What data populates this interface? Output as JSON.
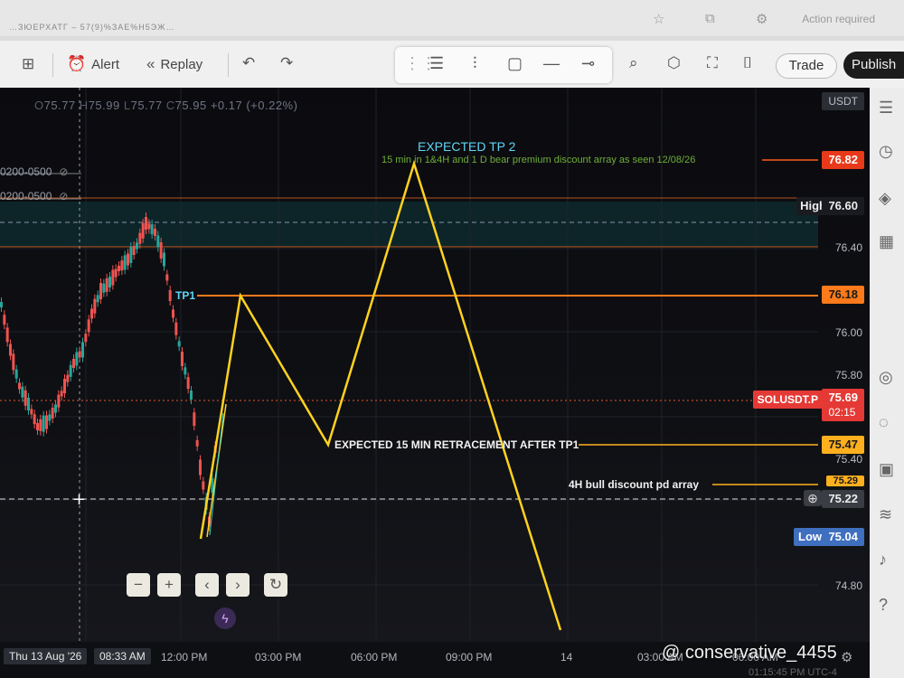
{
  "browser": {
    "tab_text": "…ЗЮЕРХАТГ – 57(9)%ЗАЕ%Н5ЭЖ…",
    "status": "Action required"
  },
  "toolbar": {
    "alert_label": "Alert",
    "replay_label": "Replay",
    "trade_label": "Trade",
    "publish_label": "Publish"
  },
  "legend": {
    "o_label": "O",
    "o_value": "75.77",
    "h_label": "H",
    "h_value": "75.99",
    "l_label": "L",
    "l_value": "75.77",
    "c_label": "C",
    "c_value": "75.95",
    "change": "+0.17 (+0.22%)"
  },
  "sessions": [
    "0200-0500",
    "0200-0500"
  ],
  "currency": "USDT",
  "annotations": {
    "tp2_title": "EXPECTED TP 2",
    "tp2_note": "15 min in 1&4H and 1 D bear premium discount array as seen 12/08/26",
    "tp1": "TP1",
    "retracement": "EXPECTED 15 MIN RETRACEMENT AFTER TP1",
    "bull_array": "4H bull discount pd array"
  },
  "price_axis": {
    "ticks": [
      "76.40",
      "76.00",
      "75.80",
      "75.40",
      "74.80"
    ],
    "tags": {
      "tp2": "76.82",
      "high_label": "High",
      "high": "76.60",
      "tp1": "76.18",
      "symbol": "SOLUSDT.P",
      "symbol_price": "75.69",
      "countdown": "02:15",
      "retrace": "75.47",
      "bull_array": "75.29",
      "crosshair": "75.22",
      "low_label": "Low",
      "low": "75.04"
    }
  },
  "time_axis": [
    "Thu 13 Aug '26",
    "08:33 AM",
    "12:00 PM",
    "03:00 PM",
    "06:00 PM",
    "09:00 PM",
    "14",
    "03:00 AM",
    "06:00 AM"
  ],
  "controls": {
    "minus": "−",
    "plus": "+",
    "left": "‹",
    "right": "›",
    "reset": "↻"
  },
  "watermark": "@ conservative_4455",
  "clock": "01:15:45 PM UTC-4",
  "colors": {
    "bull": "#26a69a",
    "bear": "#ef5350",
    "projection": "#ffd21f",
    "orange_line": "#ff6d00",
    "tp2_tag": "#e8391a",
    "symbol_tag": "#e53935",
    "low_tag": "#3f6fbf"
  }
}
